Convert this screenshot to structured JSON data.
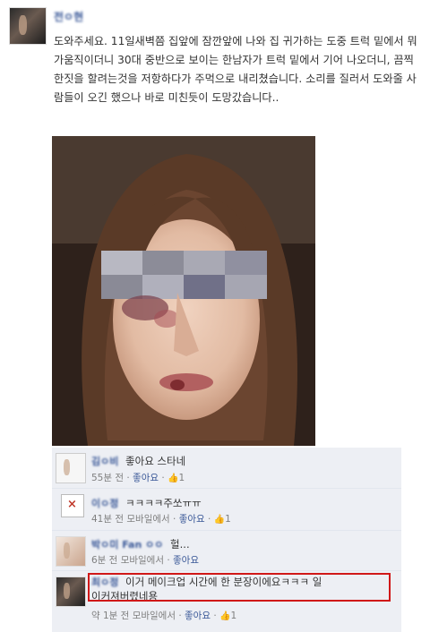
{
  "post": {
    "author": "전ㅇ현",
    "text": "도와주세요. 11일새벽쯤 집앞에 잠깐앞에 나와 집 귀가하는 도중 트럭 밑에서 뭐가움직이더니 30대 중반으로 보이는 한남자가 트럭 밑에서 기어 나오더니, 끔찍한짓을 할려는것을 저항하다가 주먹으로 내리쳤습니다. 소리를 질러서 도와줄 사람들이 오긴 했으나 바로 미친듯이 도망갔습니다.."
  },
  "comments": [
    {
      "name": "김ㅇ비",
      "text": "좋아요 스타네",
      "time": "55분 전",
      "source": "",
      "like": "좋아요",
      "likes": "1"
    },
    {
      "name": "이ㅇ정",
      "text": "ㅋㅋㅋㅋ주쏘ㅠㅠ",
      "time": "41분 전",
      "source": "모바일에서",
      "like": "좋아요",
      "likes": "1"
    },
    {
      "name": "박ㅇ미 Fan ㅇㅇ",
      "text": "헐...",
      "time": "6분 전",
      "source": "모바일에서",
      "like": "좋아요",
      "likes": ""
    },
    {
      "name": "최ㅇ정",
      "text": "이거 메이크업 시간에 한 분장이에요ㅋㅋㅋ 일",
      "text2": "이커져버렸네용",
      "time": "약 1분 전",
      "source": "모바일에서",
      "like": "좋아요",
      "likes": "1"
    }
  ],
  "icons": {
    "like": "thumbs-up-icon",
    "broken_image": "broken-image-icon"
  },
  "colors": {
    "link": "#3b5998",
    "highlight": "#d01818",
    "comment_bg": "#edeff4"
  }
}
